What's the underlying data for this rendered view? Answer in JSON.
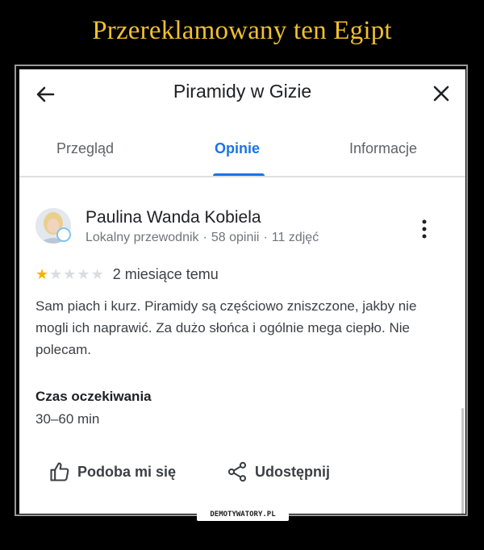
{
  "meme_title": "Przereklamowany ten Egipt",
  "header": {
    "title": "Piramidy w Gizie",
    "back_icon": "arrow-left-icon",
    "close_icon": "close-icon"
  },
  "tabs": [
    {
      "label": "Przegląd",
      "active": false
    },
    {
      "label": "Opinie",
      "active": true
    },
    {
      "label": "Informacje",
      "active": false
    }
  ],
  "review": {
    "author": "Paulina Wanda Kobiela",
    "author_meta": [
      "Lokalny przewodnik",
      "·",
      "58 opinii",
      "·",
      "11 zdjęć"
    ],
    "rating": 1,
    "rating_max": 5,
    "date": "2 miesiące temu",
    "text": "Sam piach i kurz. Piramidy są częściowo zniszczone, jakby nie mogli ich naprawić. Za dużo słońca i ogólnie mega ciepło. Nie polecam.",
    "wait_label": "Czas oczekiwania",
    "wait_value": "30–60 min",
    "actions": {
      "like": "Podoba mi się",
      "share": "Udostępnij"
    }
  },
  "watermark": "DEMOTYWATORY.PL",
  "colors": {
    "accent": "#1a73e8",
    "star_on": "#f5b400",
    "star_off": "#dadce0",
    "meme_title": "#f0c02d"
  }
}
